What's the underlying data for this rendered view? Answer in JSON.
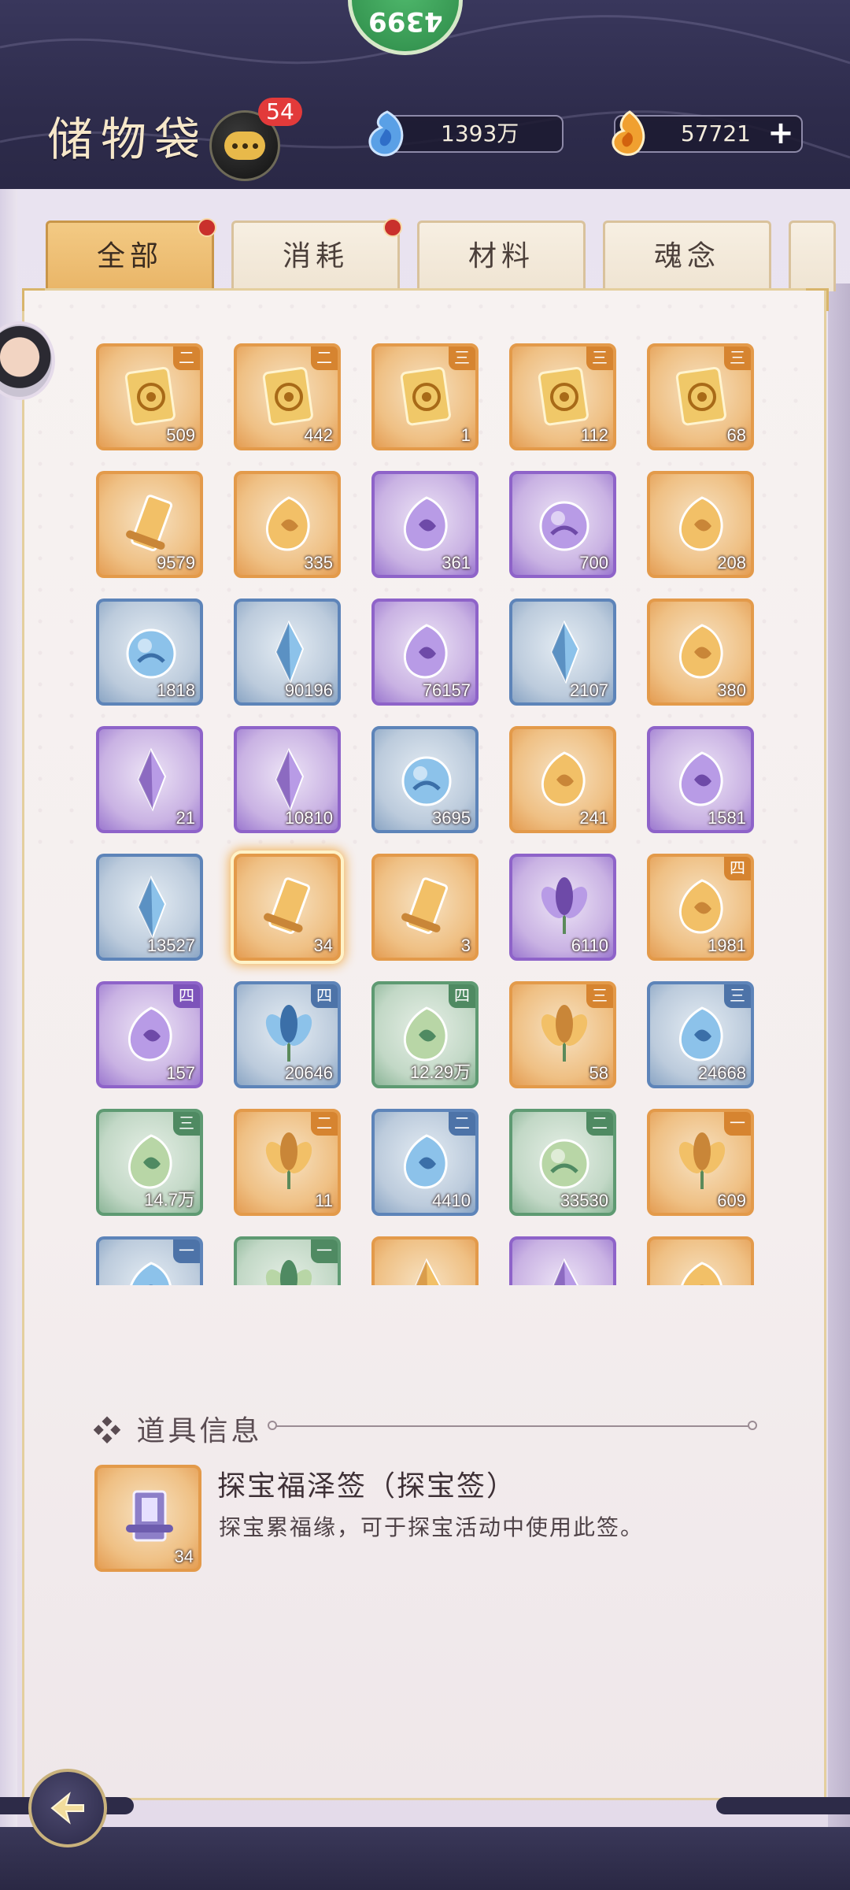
{
  "header": {
    "emblem_text": "4399",
    "title": "储物袋",
    "chat_badge": "54",
    "currency1": "1393万",
    "currency2": "57721"
  },
  "tabs": [
    {
      "label": "全部",
      "active": true,
      "dot": true
    },
    {
      "label": "消耗",
      "active": false,
      "dot": true
    },
    {
      "label": "材料",
      "active": false,
      "dot": false
    },
    {
      "label": "魂念",
      "active": false,
      "dot": false
    }
  ],
  "grid": {
    "items": [
      {
        "qty": "509",
        "tier": "二",
        "rarity": "orange",
        "icon": "gold-scroll-coin-icon"
      },
      {
        "qty": "442",
        "tier": "二",
        "rarity": "orange",
        "icon": "gold-scroll-spiral-icon"
      },
      {
        "qty": "1",
        "tier": "三",
        "rarity": "orange",
        "icon": "gold-scroll-dragon-icon"
      },
      {
        "qty": "112",
        "tier": "三",
        "rarity": "orange",
        "icon": "gold-scroll-coin-icon"
      },
      {
        "qty": "68",
        "tier": "三",
        "rarity": "orange",
        "icon": "gold-scroll-spiral-icon"
      },
      {
        "qty": "9579",
        "tier": "",
        "rarity": "orange",
        "icon": "scroll-bundle-icon"
      },
      {
        "qty": "335",
        "tier": "",
        "rarity": "orange",
        "icon": "golden-fruit-icon"
      },
      {
        "qty": "361",
        "tier": "",
        "rarity": "purple",
        "icon": "crimson-seal-icon"
      },
      {
        "qty": "700",
        "tier": "",
        "rarity": "purple",
        "icon": "amber-orb-icon"
      },
      {
        "qty": "208",
        "tier": "",
        "rarity": "orange",
        "icon": "fox-spirit-icon"
      },
      {
        "qty": "1818",
        "tier": "",
        "rarity": "blue",
        "icon": "blue-orb-icon"
      },
      {
        "qty": "90196",
        "tier": "",
        "rarity": "blue",
        "icon": "jade-shard-icon"
      },
      {
        "qty": "76157",
        "tier": "",
        "rarity": "purple",
        "icon": "violet-sigil-icon"
      },
      {
        "qty": "2107",
        "tier": "",
        "rarity": "blue",
        "icon": "ice-crystal-icon"
      },
      {
        "qty": "380",
        "tier": "",
        "rarity": "orange",
        "icon": "fortune-pouch-icon"
      },
      {
        "qty": "21",
        "tier": "",
        "rarity": "purple",
        "icon": "purple-crystal-icon"
      },
      {
        "qty": "10810",
        "tier": "",
        "rarity": "purple",
        "icon": "purple-crystal-cluster-icon"
      },
      {
        "qty": "3695",
        "tier": "",
        "rarity": "blue",
        "icon": "spirit-egg-icon"
      },
      {
        "qty": "241",
        "tier": "",
        "rarity": "orange",
        "icon": "yin-yang-sun-icon"
      },
      {
        "qty": "1581",
        "tier": "",
        "rarity": "purple",
        "icon": "swirl-cloud-icon"
      },
      {
        "qty": "13527",
        "tier": "",
        "rarity": "blue",
        "icon": "amber-crystal-icon"
      },
      {
        "qty": "34",
        "tier": "",
        "rarity": "orange",
        "icon": "treasure-slip-icon",
        "selected": true
      },
      {
        "qty": "3",
        "tier": "",
        "rarity": "orange",
        "icon": "purple-scroll-icon"
      },
      {
        "qty": "6110",
        "tier": "",
        "rarity": "purple",
        "icon": "jade-leaf-icon"
      },
      {
        "qty": "1981",
        "tier": "四",
        "rarity": "orange",
        "icon": "serpent-ribbon-icon"
      },
      {
        "qty": "157",
        "tier": "四",
        "rarity": "purple",
        "icon": "red-berries-icon"
      },
      {
        "qty": "20646",
        "tier": "四",
        "rarity": "blue",
        "icon": "blue-lotus-icon"
      },
      {
        "qty": "12.29万",
        "tier": "四",
        "rarity": "green",
        "icon": "pale-vase-icon"
      },
      {
        "qty": "58",
        "tier": "三",
        "rarity": "orange",
        "icon": "blue-lily-icon"
      },
      {
        "qty": "24668",
        "tier": "三",
        "rarity": "blue",
        "icon": "purple-mushroom-icon"
      },
      {
        "qty": "14.7万",
        "tier": "三",
        "rarity": "green",
        "icon": "horn-shell-icon"
      },
      {
        "qty": "11",
        "tier": "二",
        "rarity": "orange",
        "icon": "violet-lotus-icon"
      },
      {
        "qty": "4410",
        "tier": "二",
        "rarity": "blue",
        "icon": "sugar-cubes-icon"
      },
      {
        "qty": "33530",
        "tier": "二",
        "rarity": "green",
        "icon": "jade-ring-icon"
      },
      {
        "qty": "609",
        "tier": "一",
        "rarity": "orange",
        "icon": "purple-grass-icon"
      },
      {
        "qty": "",
        "tier": "一",
        "rarity": "blue",
        "icon": "red-fungus-icon"
      },
      {
        "qty": "",
        "tier": "一",
        "rarity": "green",
        "icon": "coral-icon"
      },
      {
        "qty": "",
        "tier": "",
        "rarity": "orange",
        "icon": "yellow-crystal-icon"
      },
      {
        "qty": "",
        "tier": "",
        "rarity": "purple",
        "icon": "violet-shard-icon"
      },
      {
        "qty": "",
        "tier": "",
        "rarity": "orange",
        "icon": "teal-stone-icon"
      }
    ]
  },
  "info": {
    "heading": "道具信息",
    "item_name": "探宝福泽签（探宝签）",
    "item_desc": "探宝累福缘，可于探宝活动中使用此签。",
    "item_qty": "34"
  },
  "colors": {
    "orange": "#e39a4a",
    "purple": "#8e63c9",
    "blue": "#5d84b9",
    "green": "#5e9a72",
    "header_bg": "#2e2c4c",
    "badge_red": "#e23a3a"
  }
}
